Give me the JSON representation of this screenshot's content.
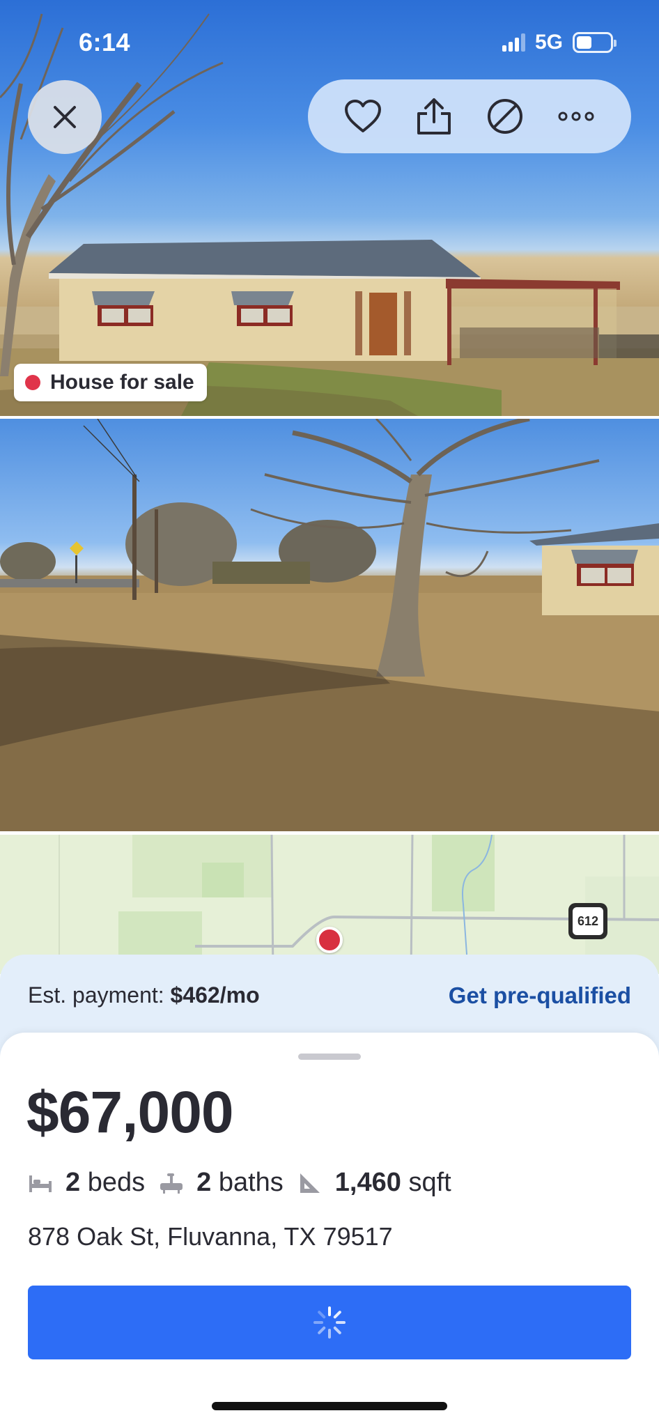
{
  "status_bar": {
    "time": "6:14",
    "network": "5G",
    "battery_level": 0.45,
    "signal_bars": 3
  },
  "top_actions": {
    "close_icon": "close-icon",
    "favorite_icon": "heart-icon",
    "share_icon": "share-icon",
    "hide_icon": "block-icon",
    "more_icon": "more-icon"
  },
  "listing": {
    "badge_label": "House for sale",
    "badge_color": "#e0344a"
  },
  "map": {
    "route_label": "612"
  },
  "payment": {
    "label": "Est. payment:",
    "amount": "$462/mo",
    "link_label": "Get pre-qualified"
  },
  "details": {
    "price": "$67,000",
    "beds_value": "2",
    "beds_label": "beds",
    "baths_value": "2",
    "baths_label": "baths",
    "sqft_value": "1,460",
    "sqft_label": "sqft",
    "address": "878 Oak St, Fluvanna, TX 79517"
  },
  "cta": {
    "state": "loading",
    "color": "#2d6df6"
  }
}
